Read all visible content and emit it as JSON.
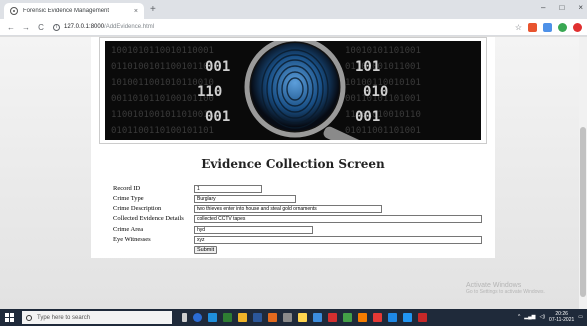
{
  "browser": {
    "tab_title": "Forensic Evidence Management",
    "tab_close": "×",
    "new_tab": "+",
    "window_controls": [
      "–",
      "□",
      "×"
    ],
    "nav": {
      "back": "←",
      "forward": "→",
      "reload": "C"
    },
    "url_host": "127.0.0.1:8000",
    "url_path": "/AddEvidence.html"
  },
  "page": {
    "heading": "Evidence Collection Screen",
    "form": {
      "fields": [
        {
          "label": "Record ID",
          "value": "1"
        },
        {
          "label": "Crime Type",
          "value": "Burglary"
        },
        {
          "label": "Crime Description",
          "value": "two thieves enter into house and steal gold ornaments"
        },
        {
          "label": "Collected Evidence Details",
          "value": "collected CCTV tapes"
        },
        {
          "label": "Crime Area",
          "value": "hyd"
        },
        {
          "label": "Eye Witnesses",
          "value": "xyz"
        }
      ],
      "submit_label": "Submit"
    },
    "banner": {
      "icon": "fingerprint-magnifier-image"
    }
  },
  "watermark": {
    "title": "Activate Windows",
    "subtitle": "Go to Settings to activate Windows."
  },
  "taskbar": {
    "search_placeholder": "Type here to search",
    "time": "20:26",
    "date": "07-11-2021"
  },
  "colors": {
    "taskbar": "#1f2a3a",
    "tab_strip": "#dee1e6",
    "banner_glow": "#1e90ff"
  }
}
